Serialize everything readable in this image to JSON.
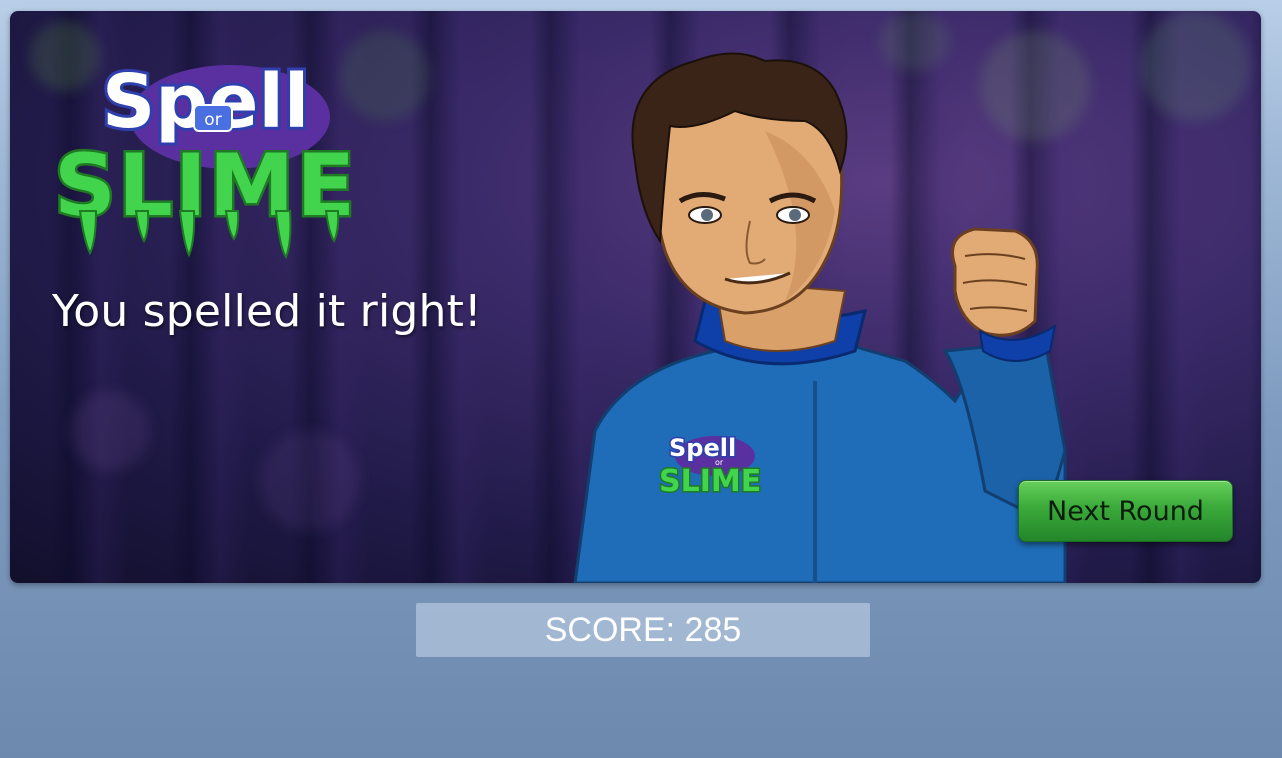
{
  "logo": {
    "word_top": "Spell",
    "word_mid": "or",
    "word_bottom": "SLIME"
  },
  "message": {
    "text": "You spelled it right!"
  },
  "host": {
    "shirt_logo_top": "Spell",
    "shirt_logo_mid": "or",
    "shirt_logo_bottom": "SLIME"
  },
  "actions": {
    "next_round_label": "Next Round"
  },
  "score": {
    "label": "SCORE: 285"
  },
  "colors": {
    "slime_green": "#3fd24a",
    "spell_blue": "#2f3fae",
    "shirt_blue": "#1f6db8",
    "button_green": "#3aa93a"
  }
}
